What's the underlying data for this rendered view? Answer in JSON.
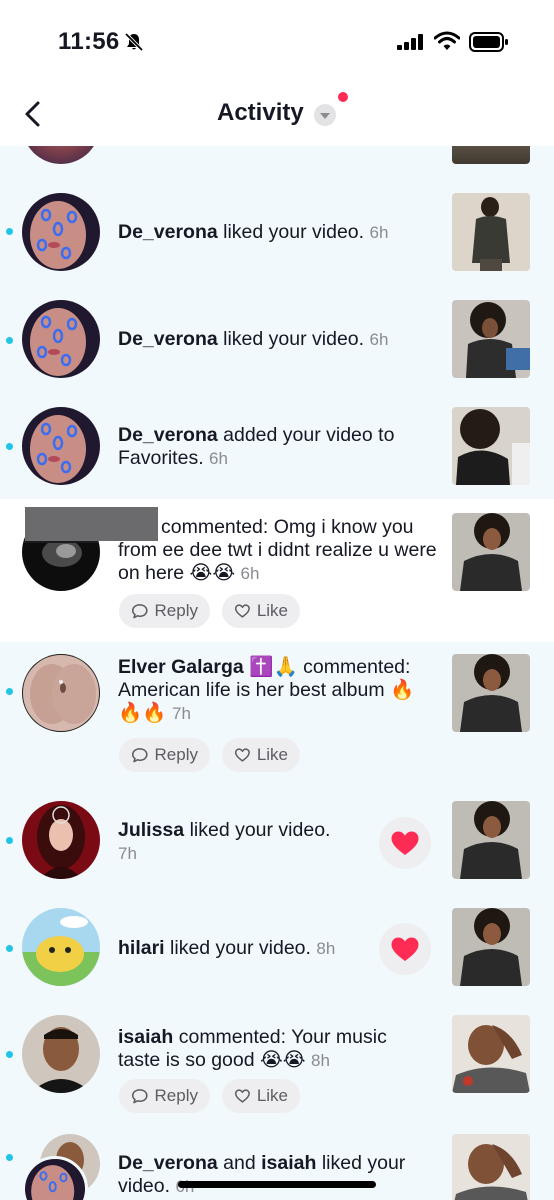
{
  "status": {
    "time": "11:56"
  },
  "header": {
    "title": "Activity"
  },
  "actions": {
    "reply": "Reply",
    "like": "Like"
  },
  "rows": [
    {
      "user": "De_verona",
      "text": "liked your video.",
      "time": "6h"
    },
    {
      "user": "De_verona",
      "text": "liked your video.",
      "time": "6h"
    },
    {
      "user": "De_verona",
      "text": "added your video to Favorites.",
      "time": "6h"
    },
    {
      "user": "",
      "text": "commented: Omg i know you from ee dee twt i didnt realize u were on here 😭😭",
      "time": "6h"
    },
    {
      "user": "Elver Galarga ✝️🙏",
      "text": "commented: American life is her best album 🔥🔥🔥",
      "time": "7h"
    },
    {
      "user": "Julissa",
      "text": "liked your video.",
      "time": "7h"
    },
    {
      "user": "hilari",
      "text": "liked your video.",
      "time": "8h"
    },
    {
      "user": "isaiah",
      "text": "commented: Your music taste is so good 😭😭",
      "time": "8h"
    },
    {
      "user": "De_verona",
      "conj": "and",
      "user2": "isaiah",
      "text": "liked your video.",
      "time": "6h"
    }
  ],
  "icons": [
    "back-chevron-icon",
    "dropdown-caret-icon",
    "bell-slash-icon",
    "signal-icon",
    "wifi-icon",
    "battery-icon",
    "reply-icon",
    "like-heart-icon",
    "liked-heart-icon"
  ],
  "colors": {
    "unread_bg": "#f1f9fc",
    "unread_dot": "#20c4e6",
    "heart": "#fe2c55"
  }
}
